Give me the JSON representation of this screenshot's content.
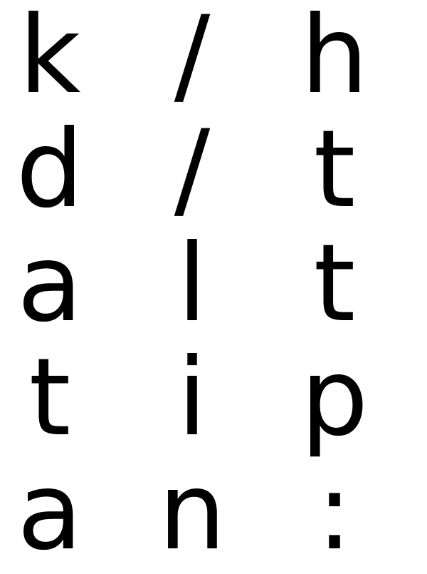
{
  "grid": {
    "rows": [
      [
        "k",
        "/",
        "h"
      ],
      [
        "d",
        "/",
        "t"
      ],
      [
        "a",
        "l",
        "t"
      ],
      [
        "t",
        "i",
        "p"
      ],
      [
        "a",
        "n",
        ":"
      ]
    ]
  },
  "colors": {
    "text": "#000000",
    "background": "#ffffff"
  }
}
